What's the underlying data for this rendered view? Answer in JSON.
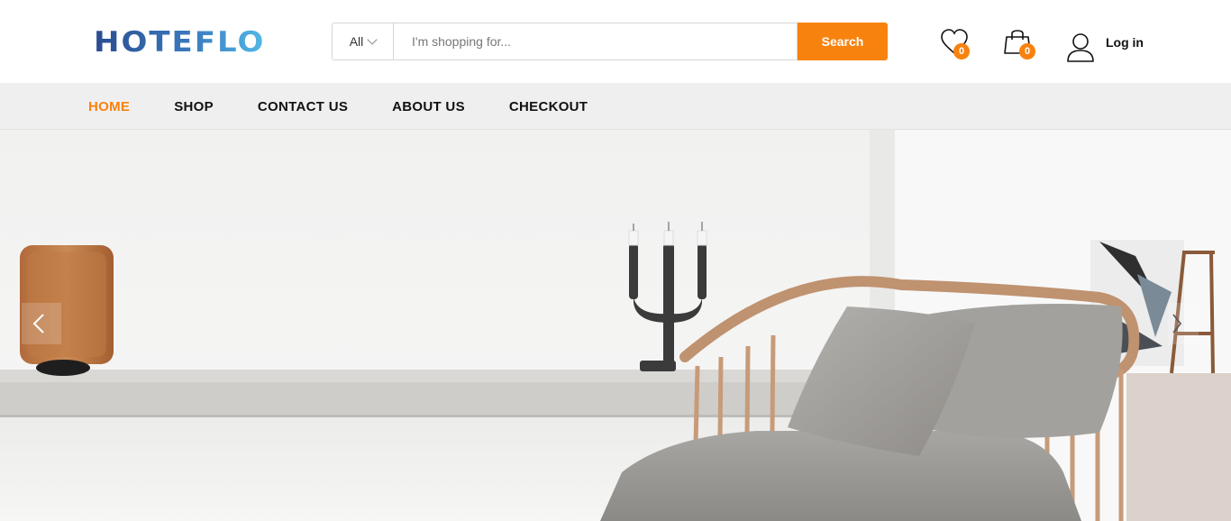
{
  "header": {
    "logo_text": "HOTEFLO",
    "search": {
      "category": "All",
      "placeholder": "I'm shopping for...",
      "value": "",
      "button_label": "Search"
    },
    "wishlist_count": "0",
    "cart_count": "0",
    "login_label": "Log in"
  },
  "nav": {
    "items": [
      "HOME",
      "SHOP",
      "CONTACT US",
      "ABOUT US",
      "CHECKOUT"
    ],
    "active": "HOME"
  },
  "hero": {
    "icons": {
      "prev": "chevron-left-icon",
      "next": "chevron-right-icon"
    }
  },
  "colors": {
    "accent": "#f8820e",
    "nav_background": "#efefef",
    "logo_dark": "#2b4c8f",
    "logo_light": "#52b8e6"
  }
}
